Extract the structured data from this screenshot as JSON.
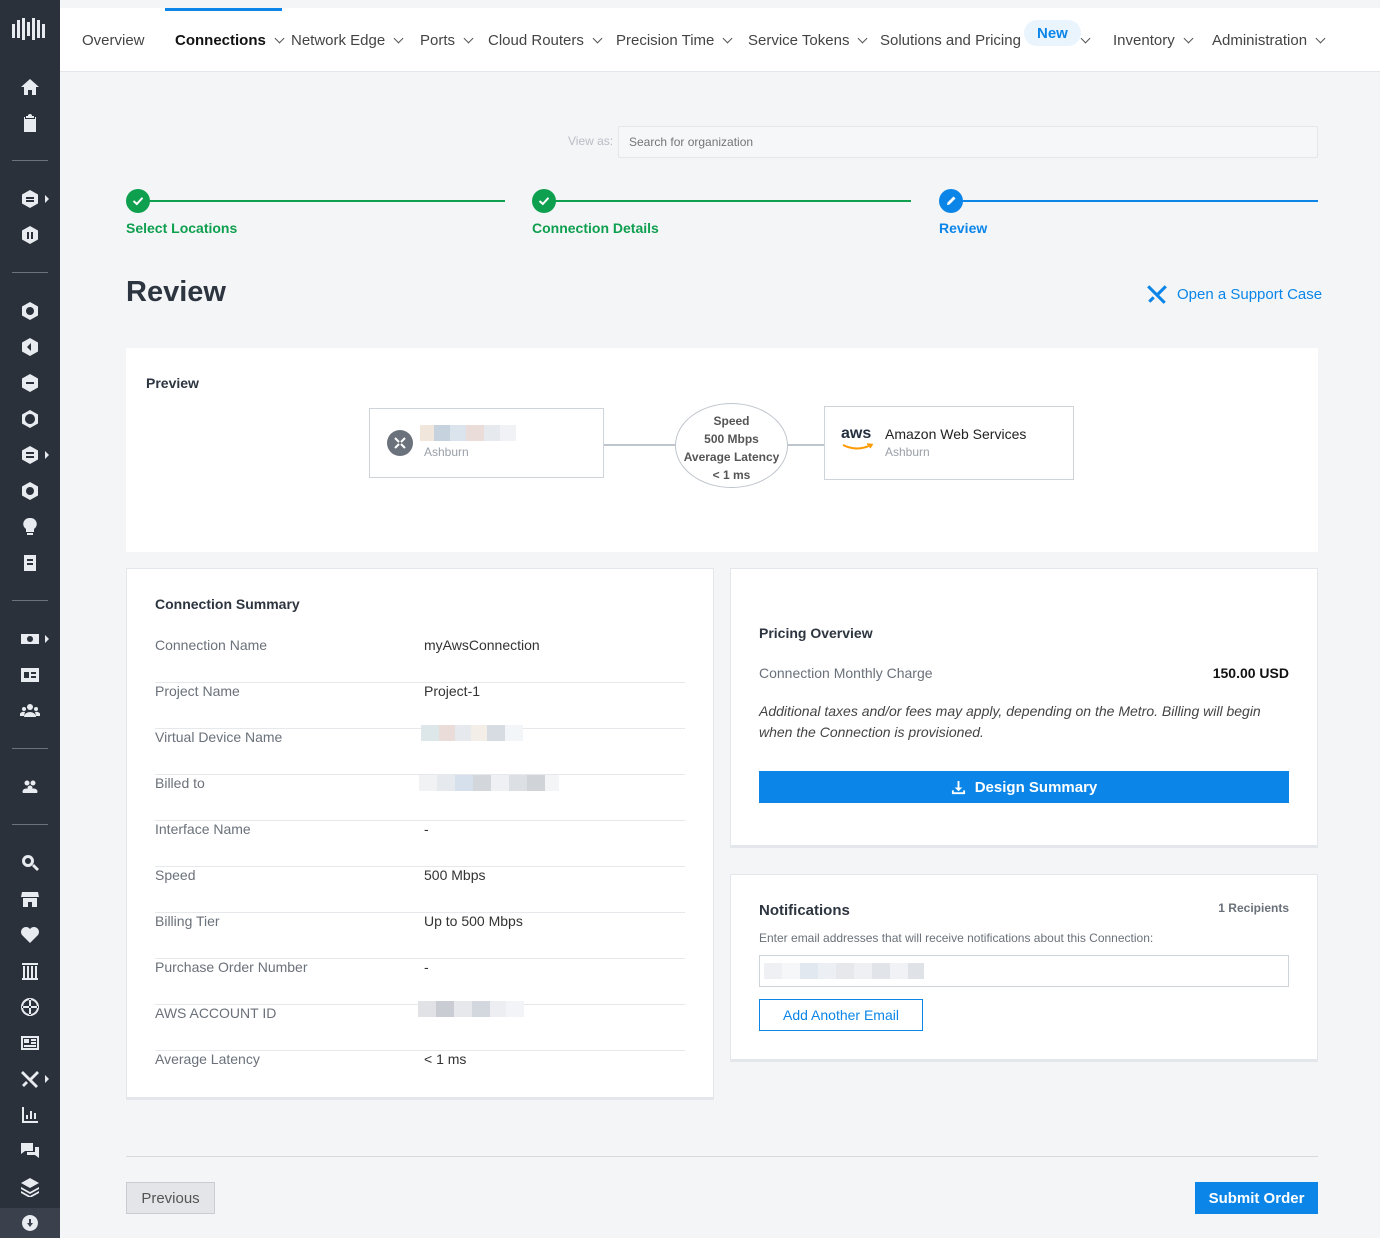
{
  "nav": {
    "items": [
      {
        "label": "Overview"
      },
      {
        "label": "Connections"
      },
      {
        "label": "Network Edge"
      },
      {
        "label": "Ports"
      },
      {
        "label": "Cloud Routers"
      },
      {
        "label": "Precision Time"
      },
      {
        "label": "Service Tokens"
      },
      {
        "label": "Solutions and Pricing"
      },
      {
        "label": "Inventory"
      },
      {
        "label": "Administration"
      }
    ],
    "new_badge": "New"
  },
  "view_as": {
    "label": "View as:",
    "placeholder": "Search for organization"
  },
  "stepper": {
    "steps": [
      {
        "label": "Select Locations",
        "state": "complete"
      },
      {
        "label": "Connection Details",
        "state": "complete"
      },
      {
        "label": "Review",
        "state": "active"
      }
    ]
  },
  "page": {
    "title": "Review",
    "support_link": "Open a Support Case"
  },
  "preview": {
    "title": "Preview",
    "source": {
      "location": "Ashburn"
    },
    "speed": {
      "speed_label": "Speed",
      "speed_value": "500 Mbps",
      "latency_label": "Average Latency",
      "latency_value": "< 1 ms"
    },
    "destination": {
      "logo_text": "aws",
      "name": "Amazon Web Services",
      "location": "Ashburn"
    }
  },
  "summary": {
    "title": "Connection Summary",
    "rows": [
      {
        "key": "Connection Name",
        "value": "myAwsConnection"
      },
      {
        "key": "Project Name",
        "value": "Project-1"
      },
      {
        "key": "Virtual Device Name",
        "value": ""
      },
      {
        "key": "Billed to",
        "value": ""
      },
      {
        "key": "Interface Name",
        "value": "-"
      },
      {
        "key": "Speed",
        "value": "500 Mbps"
      },
      {
        "key": "Billing Tier",
        "value": "Up to 500 Mbps"
      },
      {
        "key": "Purchase Order Number",
        "value": "-"
      },
      {
        "key": "AWS ACCOUNT ID",
        "value": ""
      },
      {
        "key": "Average Latency",
        "value": "< 1 ms"
      }
    ]
  },
  "pricing": {
    "title": "Pricing Overview",
    "charge_label": "Connection Monthly Charge",
    "charge_value": "150.00 USD",
    "note": "Additional taxes and/or fees may apply, depending on the Metro. Billing will begin when the Connection is provisioned.",
    "design_button": "Design Summary"
  },
  "notifications": {
    "title": "Notifications",
    "count": "1 Recipients",
    "help": "Enter email addresses that will receive notifications about this Connection:",
    "add_button": "Add Another Email"
  },
  "footer": {
    "previous": "Previous",
    "submit": "Submit Order"
  },
  "colors": {
    "accent": "#0b86e8",
    "success": "#0e9f4f",
    "sidebar": "#2b313b"
  }
}
